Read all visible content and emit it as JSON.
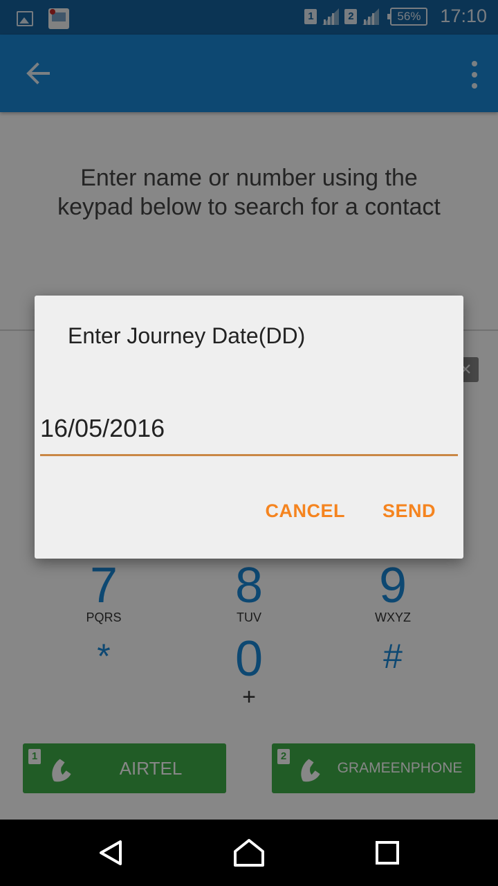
{
  "status_bar": {
    "icons": [
      "image-icon",
      "app-notification-icon"
    ],
    "sim1": "1",
    "sim2": "2",
    "battery": "56%",
    "time": "17:10"
  },
  "app_bar": {
    "back_icon": "arrow-back-icon",
    "menu_icon": "more-vert-icon"
  },
  "content": {
    "hint": "Enter name or number using the keypad below to search for a contact"
  },
  "keypad": {
    "keys": [
      {
        "digit": "7",
        "letters": "PQRS"
      },
      {
        "digit": "8",
        "letters": "TUV"
      },
      {
        "digit": "9",
        "letters": "WXYZ"
      },
      {
        "digit": "*",
        "letters": ""
      },
      {
        "digit": "0",
        "letters": "+"
      },
      {
        "digit": "#",
        "letters": ""
      }
    ]
  },
  "call_buttons": [
    {
      "sim": "1",
      "label": "AIRTEL"
    },
    {
      "sim": "2",
      "label": "GRAMEENPHONE"
    }
  ],
  "dialog": {
    "title": "Enter Journey Date(DD)",
    "input_value": "16/05/2016",
    "cancel_label": "CANCEL",
    "send_label": "SEND"
  },
  "colors": {
    "primary": "#1a88d8",
    "status_bar": "#16639f",
    "accent": "#f5841f",
    "call_green": "#3fae49"
  }
}
